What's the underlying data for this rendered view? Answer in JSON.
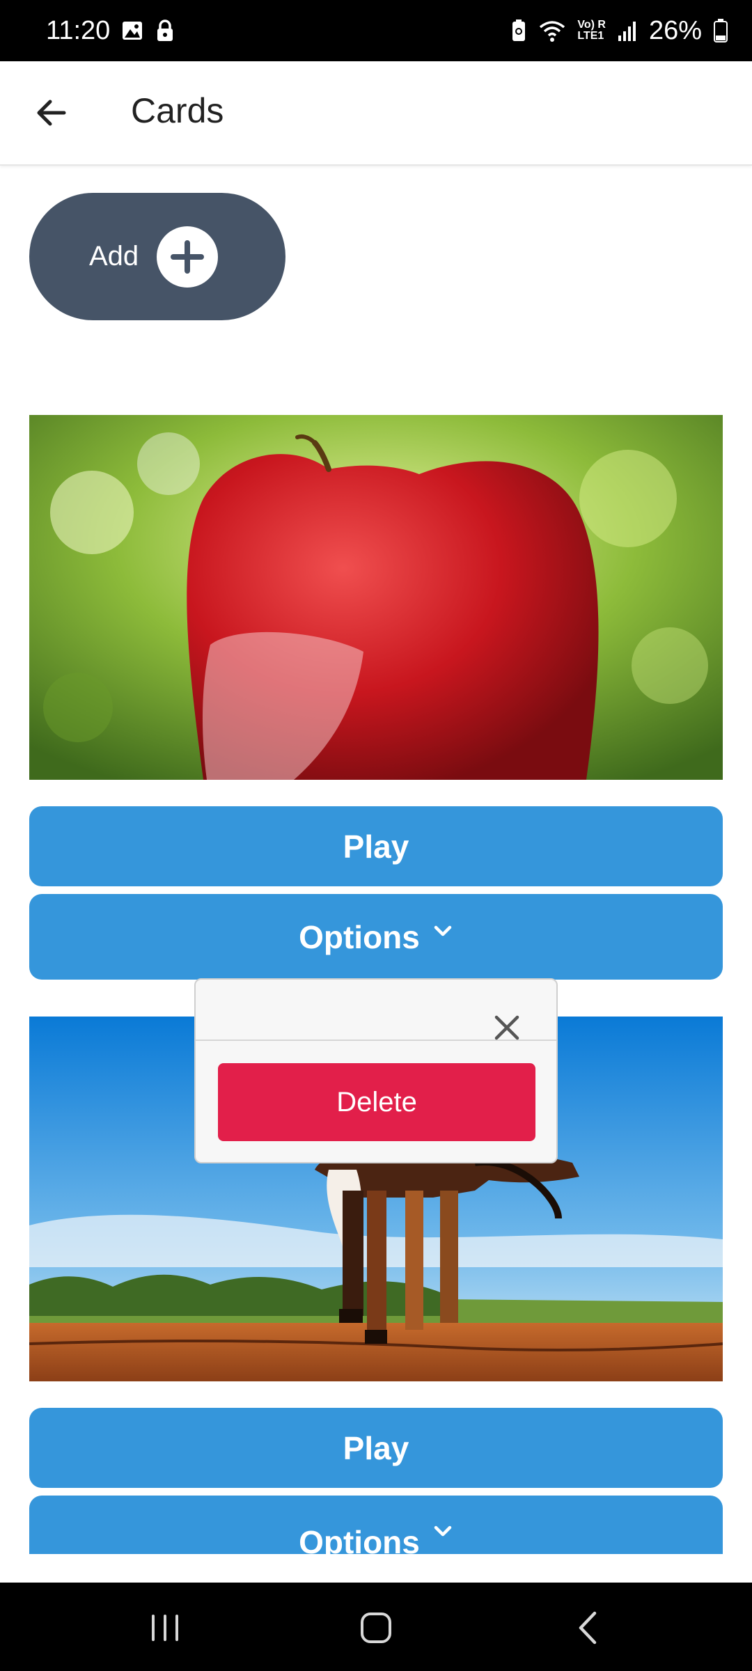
{
  "status_bar": {
    "time": "11:20",
    "battery": "26%",
    "volte_text": "Vo) R\nLTE1",
    "icons": [
      "gallery-icon",
      "lock-icon",
      "battery-saver-icon",
      "wifi-icon",
      "signal-icon",
      "battery-icon"
    ]
  },
  "appbar": {
    "title": "Cards",
    "back_icon": "arrow-left-icon"
  },
  "add_button": {
    "label": "Add",
    "icon": "plus-circle-icon"
  },
  "cards": [
    {
      "image": "apple-photo",
      "play_label": "Play",
      "options_label": "Options"
    },
    {
      "image": "horse-photo",
      "play_label": "Play",
      "options_label": "Options"
    }
  ],
  "popover": {
    "delete_label": "Delete",
    "close_icon": "close-icon"
  },
  "colors": {
    "button_blue": "#3596db",
    "add_button": "#465467",
    "delete_red": "#e21f4a"
  },
  "nav_bar": {
    "items": [
      "recent-apps-icon",
      "home-icon",
      "back-icon"
    ]
  }
}
